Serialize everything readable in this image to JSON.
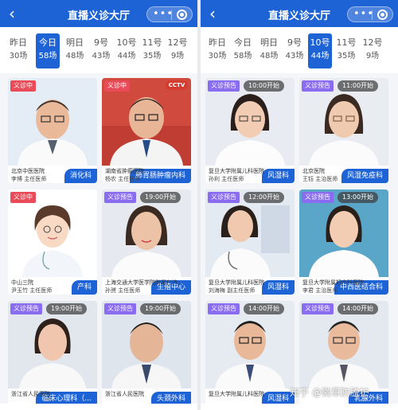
{
  "app": {
    "title": "直播义诊大厅"
  },
  "left": {
    "dates": [
      {
        "day": "昨日",
        "count": "30场"
      },
      {
        "day": "今日",
        "count": "58场"
      },
      {
        "day": "明日",
        "count": "48场"
      },
      {
        "day": "9号",
        "count": "43场"
      },
      {
        "day": "10号",
        "count": "44场"
      },
      {
        "day": "11号",
        "count": "35场"
      },
      {
        "day": "12号",
        "count": "9场"
      }
    ],
    "cards": [
      {
        "badge": "义诊中",
        "time": "",
        "dept": "消化科",
        "hospital": "北京中医医院",
        "doctor": "李博  主任医师"
      },
      {
        "badge": "义诊中",
        "time": "",
        "dept": "肺胃肠肿瘤内科",
        "hospital": "湖南省肿瘤医院",
        "doctor": "杨农  主任医师"
      },
      {
        "badge": "义诊中",
        "time": "",
        "dept": "产科",
        "hospital": "中山三院",
        "doctor": "尹玉竹  主任医师"
      },
      {
        "badge": "义诊预告",
        "time": "19:00开始",
        "dept": "生殖中心",
        "hospital": "上海交通大学医学院附属仁济...",
        "doctor": "孙赟  主任医师"
      },
      {
        "badge": "义诊预告",
        "time": "19:00开始",
        "dept": "临床心理科（...",
        "hospital": "浙江省人民医院",
        "doctor": ""
      },
      {
        "badge": "义诊预告",
        "time": "19:00开始",
        "dept": "头颈外科",
        "hospital": "浙江省人民医院",
        "doctor": ""
      }
    ]
  },
  "right": {
    "dates": [
      {
        "day": "昨日",
        "count": "30场"
      },
      {
        "day": "今日",
        "count": "58场"
      },
      {
        "day": "明日",
        "count": "48场"
      },
      {
        "day": "9号",
        "count": "43场"
      },
      {
        "day": "10号",
        "count": "44场"
      },
      {
        "day": "11号",
        "count": "35场"
      },
      {
        "day": "12号",
        "count": "9场"
      }
    ],
    "cards": [
      {
        "badge": "义诊预告",
        "time": "10:00开始",
        "dept": "风湿科",
        "hospital": "复旦大学附属儿科医院",
        "doctor": "孙利  主任医师"
      },
      {
        "badge": "义诊预告",
        "time": "11:00开始",
        "dept": "风湿免疫科",
        "hospital": "北京医院",
        "doctor": "王钰  主治医师"
      },
      {
        "badge": "义诊预告",
        "time": "12:00开始",
        "dept": "风湿科",
        "hospital": "复旦大学附属儿科医院",
        "doctor": "刘海梅  副主任医师"
      },
      {
        "badge": "义诊预告",
        "time": "13:00开始",
        "dept": "中西医结合科",
        "hospital": "复旦大学附属妇产科医院",
        "doctor": "李君  主治医师"
      },
      {
        "badge": "义诊预告",
        "time": "14:00开始",
        "dept": "风湿科",
        "hospital": "复旦大学附属儿科医院",
        "doctor": ""
      },
      {
        "badge": "义诊预告",
        "time": "14:00开始",
        "dept": "乳腺外科",
        "hospital": "",
        "doctor": ""
      }
    ]
  },
  "watermark": "知乎 @微草防脱护",
  "colors": {
    "primary": "#1e63d6",
    "live": "#e94b58",
    "preview": "#8a6cf0"
  }
}
